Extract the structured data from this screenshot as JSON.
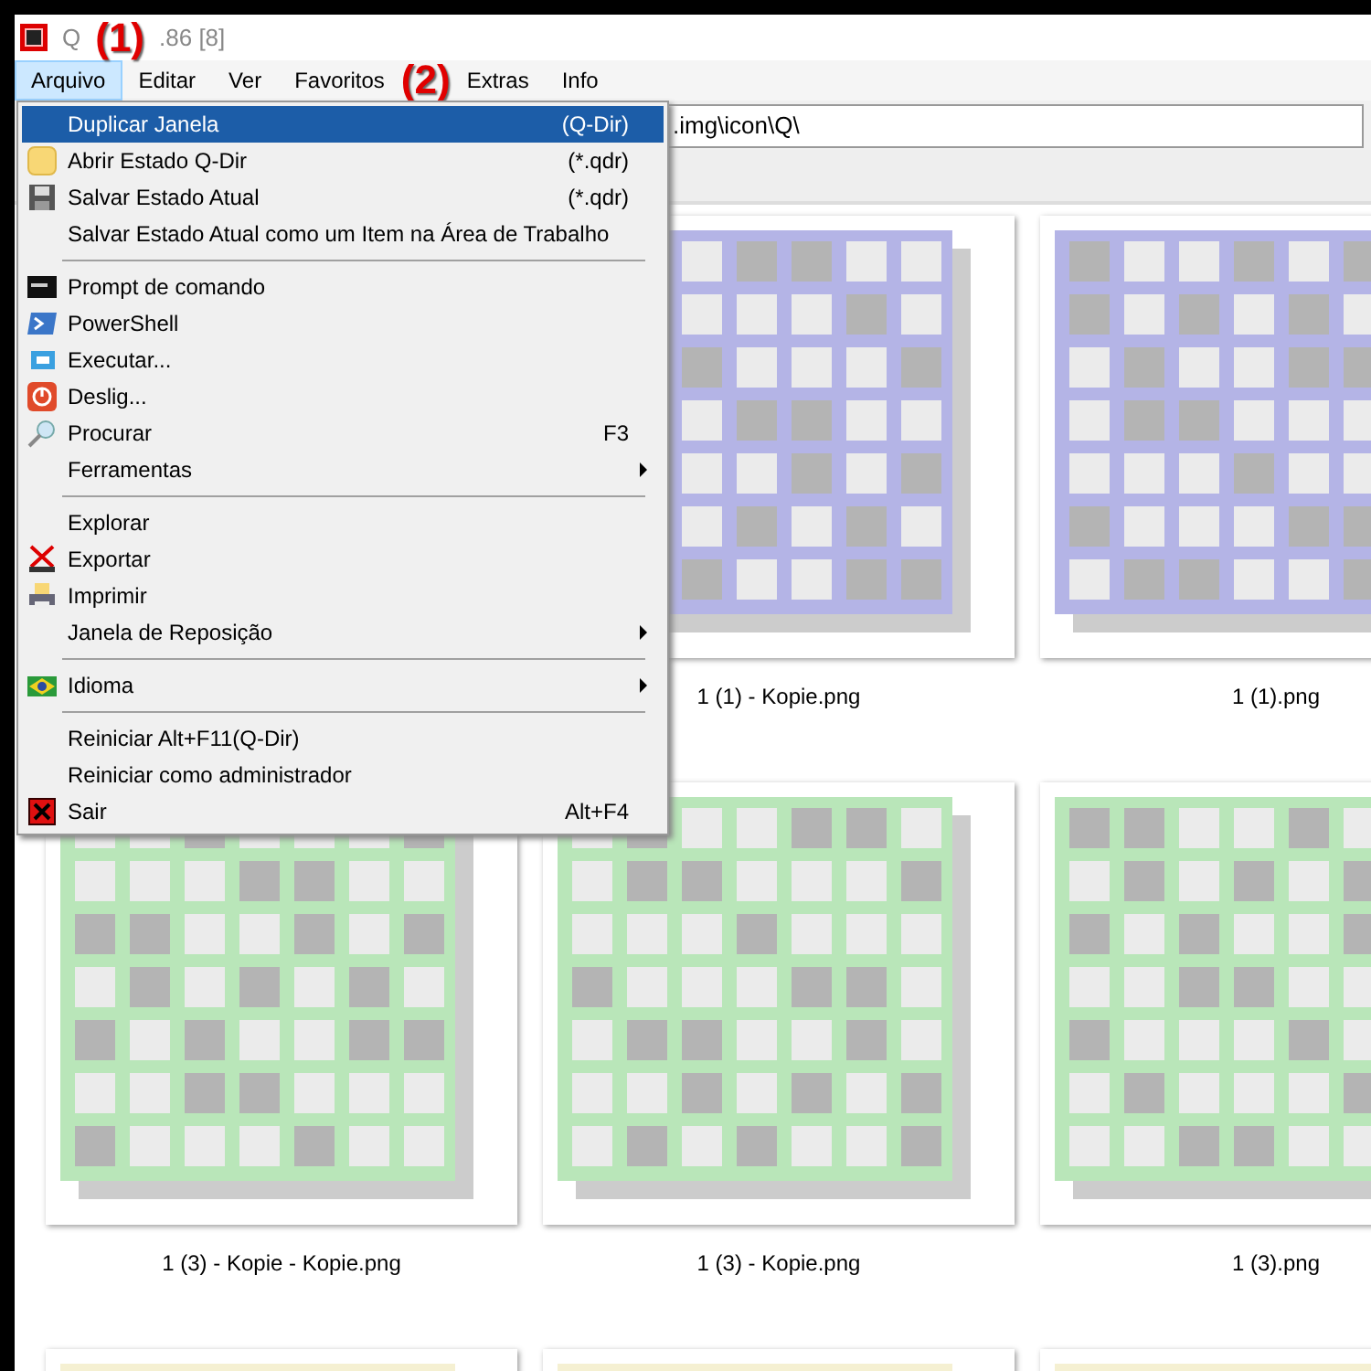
{
  "window": {
    "title_start": "Q",
    "title_end": ".86 [8]"
  },
  "annotations": [
    "(1)",
    "(2)"
  ],
  "menubar": [
    {
      "label": "Arquivo",
      "selected": true
    },
    {
      "label": "Editar",
      "selected": false
    },
    {
      "label": "Ver",
      "selected": false
    },
    {
      "label": "Favoritos",
      "selected": false
    },
    {
      "label": "Extras",
      "selected": false
    },
    {
      "label": "Info",
      "selected": false
    }
  ],
  "address": {
    "value": ".img\\icon\\Q\\"
  },
  "menu": [
    {
      "kind": "item",
      "label": "Duplicar Janela",
      "shortcut": "(Q-Dir)",
      "selected": true
    },
    {
      "kind": "item",
      "label": "Abrir Estado Q-Dir",
      "shortcut": "(*.qdr)",
      "selected": false
    },
    {
      "kind": "item",
      "label": "Salvar Estado Atual",
      "shortcut": "(*.qdr)",
      "selected": false
    },
    {
      "kind": "item",
      "label": "Salvar Estado Atual como um Item na Área de Trabalho",
      "selected": false
    },
    {
      "kind": "separator"
    },
    {
      "kind": "item",
      "label": "Prompt de comando",
      "selected": false
    },
    {
      "kind": "item",
      "label": "PowerShell",
      "selected": false
    },
    {
      "kind": "item",
      "label": "Executar...",
      "selected": false
    },
    {
      "kind": "item",
      "label": "Deslig...",
      "selected": false
    },
    {
      "kind": "item",
      "label": "Procurar",
      "shortcut": "F3",
      "selected": false
    },
    {
      "kind": "submenu",
      "label": "Ferramentas",
      "selected": false
    },
    {
      "kind": "separator"
    },
    {
      "kind": "item",
      "label": "Explorar",
      "selected": false
    },
    {
      "kind": "item",
      "label": "Exportar",
      "selected": false
    },
    {
      "kind": "item",
      "label": "Imprimir",
      "selected": false
    },
    {
      "kind": "submenu",
      "label": "Janela de Reposição",
      "selected": false
    },
    {
      "kind": "separator"
    },
    {
      "kind": "submenu",
      "label": "Idioma",
      "selected": false
    },
    {
      "kind": "separator"
    },
    {
      "kind": "item",
      "label": "Reiniciar Alt+F11(Q-Dir)",
      "selected": false
    },
    {
      "kind": "item",
      "label": "Reiniciar como administrador",
      "selected": false
    },
    {
      "kind": "item",
      "label": "Sair",
      "shortcut": "Alt+F4",
      "selected": false
    }
  ],
  "files": [
    {
      "label": "1 (1) - Kopie.png",
      "color": "#b4b4e6"
    },
    {
      "label": "1 (1).png",
      "color": "#b4b4e6"
    },
    {
      "label": "1 (3) - Kopie - Kopie.png",
      "color": "#b9e6b9"
    },
    {
      "label": "1 (3) - Kopie.png",
      "color": "#b9e6b9"
    },
    {
      "label": "1 (3).png",
      "color": "#b9e6b9"
    },
    {
      "color": "#f5f0d2"
    },
    {
      "color": "#f5f0d2"
    },
    {
      "color": "#f5f0d2"
    }
  ]
}
